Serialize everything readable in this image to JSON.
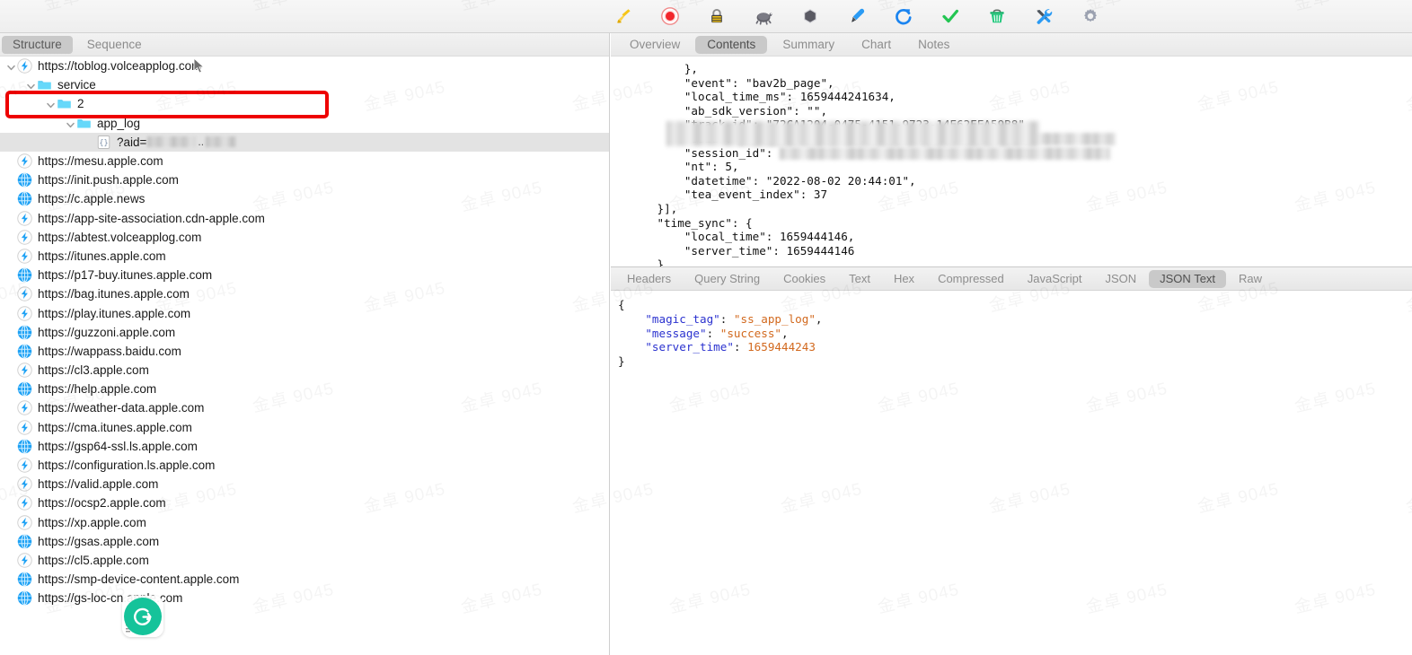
{
  "toolbar": {
    "icons": [
      {
        "name": "broom-icon",
        "label": "Clear"
      },
      {
        "name": "record-icon",
        "label": "Start/Stop Recording"
      },
      {
        "name": "lock-icon",
        "label": "SSL Proxying"
      },
      {
        "name": "turtle-icon",
        "label": "Throttling"
      },
      {
        "name": "hexagon-icon",
        "label": "Breakpoints"
      },
      {
        "name": "pen-icon",
        "label": "Compose"
      },
      {
        "name": "refresh-icon",
        "label": "Repeat"
      },
      {
        "name": "checkmark-icon",
        "label": "Validate"
      },
      {
        "name": "trash-icon",
        "label": "Delete"
      },
      {
        "name": "tools-icon",
        "label": "Tools"
      },
      {
        "name": "gear-icon",
        "label": "Settings"
      }
    ]
  },
  "left_panel": {
    "tabs": [
      {
        "label": "Structure",
        "selected": true
      },
      {
        "label": "Sequence",
        "selected": false
      }
    ],
    "tree": [
      {
        "label": "https://toblog.volceapplog.com",
        "icon": "bolt-icon",
        "indent": 0,
        "twisty": "down",
        "highlighted": true,
        "selected": false
      },
      {
        "label": "service",
        "icon": "folder-icon",
        "indent": 1,
        "twisty": "down",
        "highlighted": false,
        "selected": false
      },
      {
        "label": "2",
        "icon": "folder-icon",
        "indent": 2,
        "twisty": "down",
        "highlighted": false,
        "selected": false
      },
      {
        "label": "app_log",
        "icon": "folder-icon",
        "indent": 3,
        "twisty": "down",
        "highlighted": false,
        "selected": false
      },
      {
        "label": "?aid=",
        "icon": "braces-icon",
        "indent": 4,
        "twisty": "none",
        "highlighted": false,
        "selected": true,
        "redacted": true
      },
      {
        "label": "https://mesu.apple.com",
        "icon": "bolt-icon",
        "indent": 0,
        "twisty": "none",
        "highlighted": false,
        "selected": false
      },
      {
        "label": "https://init.push.apple.com",
        "icon": "globe-icon",
        "indent": 0,
        "twisty": "none",
        "highlighted": false,
        "selected": false
      },
      {
        "label": "https://c.apple.news",
        "icon": "globe-icon",
        "indent": 0,
        "twisty": "none",
        "highlighted": false,
        "selected": false
      },
      {
        "label": "https://app-site-association.cdn-apple.com",
        "icon": "bolt-icon",
        "indent": 0,
        "twisty": "none",
        "highlighted": false,
        "selected": false
      },
      {
        "label": "https://abtest.volceapplog.com",
        "icon": "bolt-icon",
        "indent": 0,
        "twisty": "none",
        "highlighted": false,
        "selected": false
      },
      {
        "label": "https://itunes.apple.com",
        "icon": "bolt-icon",
        "indent": 0,
        "twisty": "none",
        "highlighted": false,
        "selected": false
      },
      {
        "label": "https://p17-buy.itunes.apple.com",
        "icon": "globe-icon",
        "indent": 0,
        "twisty": "none",
        "highlighted": false,
        "selected": false
      },
      {
        "label": "https://bag.itunes.apple.com",
        "icon": "bolt-icon",
        "indent": 0,
        "twisty": "none",
        "highlighted": false,
        "selected": false
      },
      {
        "label": "https://play.itunes.apple.com",
        "icon": "bolt-icon",
        "indent": 0,
        "twisty": "none",
        "highlighted": false,
        "selected": false
      },
      {
        "label": "https://guzzoni.apple.com",
        "icon": "globe-icon",
        "indent": 0,
        "twisty": "none",
        "highlighted": false,
        "selected": false
      },
      {
        "label": "https://wappass.baidu.com",
        "icon": "globe-icon",
        "indent": 0,
        "twisty": "none",
        "highlighted": false,
        "selected": false
      },
      {
        "label": "https://cl3.apple.com",
        "icon": "bolt-icon",
        "indent": 0,
        "twisty": "none",
        "highlighted": false,
        "selected": false
      },
      {
        "label": "https://help.apple.com",
        "icon": "globe-icon",
        "indent": 0,
        "twisty": "none",
        "highlighted": false,
        "selected": false
      },
      {
        "label": "https://weather-data.apple.com",
        "icon": "bolt-icon",
        "indent": 0,
        "twisty": "none",
        "highlighted": false,
        "selected": false
      },
      {
        "label": "https://cma.itunes.apple.com",
        "icon": "bolt-icon",
        "indent": 0,
        "twisty": "none",
        "highlighted": false,
        "selected": false
      },
      {
        "label": "https://gsp64-ssl.ls.apple.com",
        "icon": "globe-icon",
        "indent": 0,
        "twisty": "none",
        "highlighted": false,
        "selected": false
      },
      {
        "label": "https://configuration.ls.apple.com",
        "icon": "bolt-icon",
        "indent": 0,
        "twisty": "none",
        "highlighted": false,
        "selected": false
      },
      {
        "label": "https://valid.apple.com",
        "icon": "bolt-icon",
        "indent": 0,
        "twisty": "none",
        "highlighted": false,
        "selected": false
      },
      {
        "label": "https://ocsp2.apple.com",
        "icon": "bolt-icon",
        "indent": 0,
        "twisty": "none",
        "highlighted": false,
        "selected": false
      },
      {
        "label": "https://xp.apple.com",
        "icon": "bolt-icon",
        "indent": 0,
        "twisty": "none",
        "highlighted": false,
        "selected": false
      },
      {
        "label": "https://gsas.apple.com",
        "icon": "globe-icon",
        "indent": 0,
        "twisty": "none",
        "highlighted": false,
        "selected": false
      },
      {
        "label": "https://cl5.apple.com",
        "icon": "bolt-icon",
        "indent": 0,
        "twisty": "none",
        "highlighted": false,
        "selected": false
      },
      {
        "label": "https://smp-device-content.apple.com",
        "icon": "globe-icon",
        "indent": 0,
        "twisty": "none",
        "highlighted": false,
        "selected": false
      },
      {
        "label": "https://gs-loc-cn.apple.com",
        "icon": "globe-icon",
        "indent": 0,
        "twisty": "none",
        "highlighted": false,
        "selected": false
      }
    ]
  },
  "right_panel": {
    "tabs": [
      {
        "label": "Overview",
        "selected": false
      },
      {
        "label": "Contents",
        "selected": true
      },
      {
        "label": "Summary",
        "selected": false
      },
      {
        "label": "Chart",
        "selected": false
      },
      {
        "label": "Notes",
        "selected": false
      }
    ],
    "request_body_lines": [
      "          },",
      "          \"event\": \"bav2b_page\",",
      "          \"local_time_ms\": 1659444241634,",
      "          \"ab_sdk_version\": \"\",",
      "          \"track_id\": \"72CA1204-0475-4151-9723-14E62EEA59B8\",",
      "          \"ssid\": \"\",",
      "          \"session_id\": \"\",",
      "          \"nt\": 5,",
      "          \"datetime\": \"2022-08-02 20:44:01\",",
      "          \"tea_event_index\": 37",
      "      }],",
      "      \"time_sync\": {",
      "          \"local_time\": 1659444146,",
      "          \"server_time\": 1659444146",
      "      }"
    ],
    "lower_tabs": [
      {
        "label": "Headers",
        "selected": false
      },
      {
        "label": "Query String",
        "selected": false
      },
      {
        "label": "Cookies",
        "selected": false
      },
      {
        "label": "Text",
        "selected": false
      },
      {
        "label": "Hex",
        "selected": false
      },
      {
        "label": "Compressed",
        "selected": false
      },
      {
        "label": "JavaScript",
        "selected": false
      },
      {
        "label": "JSON",
        "selected": false
      },
      {
        "label": "JSON Text",
        "selected": true
      },
      {
        "label": "Raw",
        "selected": false
      }
    ],
    "json_text": {
      "open_brace": "{",
      "close_brace": "}",
      "entries": [
        {
          "key": "\"magic_tag\"",
          "sep": ": ",
          "value": "\"ss_app_log\"",
          "comma": ","
        },
        {
          "key": "\"message\"",
          "sep": ": ",
          "value": "\"success\"",
          "comma": ","
        },
        {
          "key": "\"server_time\"",
          "sep": ": ",
          "value": "1659444243",
          "comma": ""
        }
      ]
    }
  },
  "overlays": {
    "watermark_text": "金卓 9045",
    "grammarly_letter": "G",
    "highlight_color": "#ee0000"
  }
}
